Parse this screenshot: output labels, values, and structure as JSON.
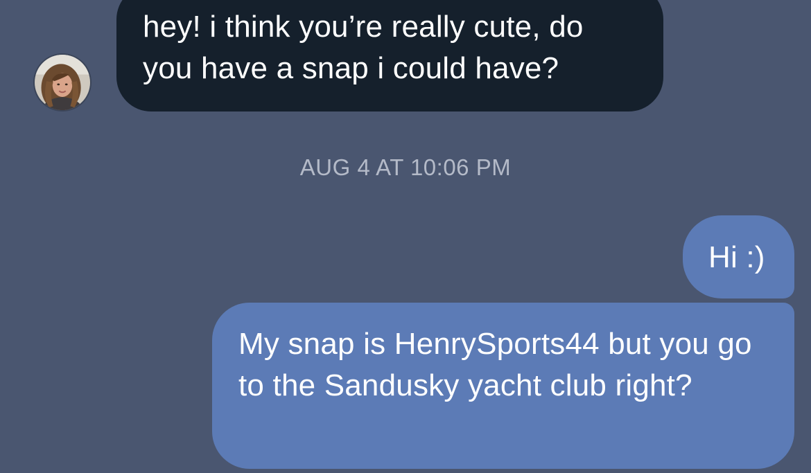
{
  "conversation": {
    "contact": {
      "avatar_icon": "profile-photo"
    },
    "messages": [
      {
        "direction": "incoming",
        "text": "hey! i think you’re really cute, do you have a snap i could have?"
      },
      {
        "direction": "outgoing",
        "text": "Hi :)"
      },
      {
        "direction": "outgoing",
        "text": "My snap is HenrySports44 but you go to the Sandusky yacht club right?"
      }
    ],
    "timestamp": "AUG 4 AT 10:06 PM"
  },
  "colors": {
    "background": "#4a5670",
    "incoming_bubble": "#15202c",
    "outgoing_bubble": "#5c7bb6",
    "timestamp_text": "#b4bac8"
  }
}
